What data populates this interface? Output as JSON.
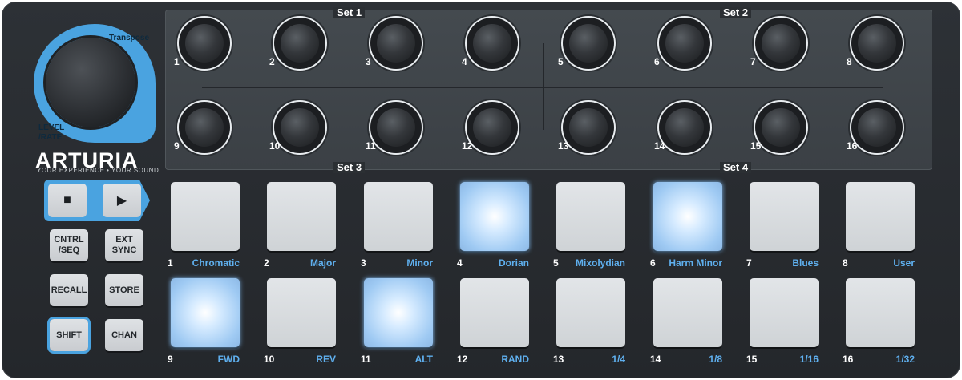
{
  "brand": {
    "logo": "ARTURIA",
    "tagline": "YOUR EXPERIENCE • YOUR SOUND"
  },
  "encoder": {
    "top_label": "Transpose",
    "bottom_label_1": "LEVEL",
    "bottom_label_2": "/RATE"
  },
  "sets": [
    "Set 1",
    "Set 2",
    "Set 3",
    "Set 4"
  ],
  "knobs": [
    "1",
    "2",
    "3",
    "4",
    "5",
    "6",
    "7",
    "8",
    "9",
    "10",
    "11",
    "12",
    "13",
    "14",
    "15",
    "16"
  ],
  "transport": {
    "stop_icon": "stop-icon",
    "play_icon": "play-icon",
    "stop_glyph": "■",
    "play_glyph": "▶"
  },
  "buttons": {
    "cntrl_seq_1": "CNTRL",
    "cntrl_seq_2": "/SEQ",
    "ext_sync_1": "EXT",
    "ext_sync_2": "SYNC",
    "recall": "RECALL",
    "store": "STORE",
    "shift": "SHIFT",
    "chan": "CHAN"
  },
  "pads": [
    {
      "num": "1",
      "name": "Chromatic",
      "lit": false
    },
    {
      "num": "2",
      "name": "Major",
      "lit": false
    },
    {
      "num": "3",
      "name": "Minor",
      "lit": false
    },
    {
      "num": "4",
      "name": "Dorian",
      "lit": true
    },
    {
      "num": "5",
      "name": "Mixolydian",
      "lit": false
    },
    {
      "num": "6",
      "name": "Harm Minor",
      "lit": true
    },
    {
      "num": "7",
      "name": "Blues",
      "lit": false
    },
    {
      "num": "8",
      "name": "User",
      "lit": false
    },
    {
      "num": "9",
      "name": "FWD",
      "lit": true
    },
    {
      "num": "10",
      "name": "REV",
      "lit": false
    },
    {
      "num": "11",
      "name": "ALT",
      "lit": true
    },
    {
      "num": "12",
      "name": "RAND",
      "lit": false
    },
    {
      "num": "13",
      "name": "1/4",
      "lit": false
    },
    {
      "num": "14",
      "name": "1/8",
      "lit": false
    },
    {
      "num": "15",
      "name": "1/16",
      "lit": false
    },
    {
      "num": "16",
      "name": "1/32",
      "lit": false
    }
  ],
  "colors": {
    "accent": "#4aa3e0",
    "body": "#2a2d31",
    "pad": "#d9dcdf",
    "pad_lit": "#a8d0f5",
    "label_blue": "#5fb0ef"
  }
}
